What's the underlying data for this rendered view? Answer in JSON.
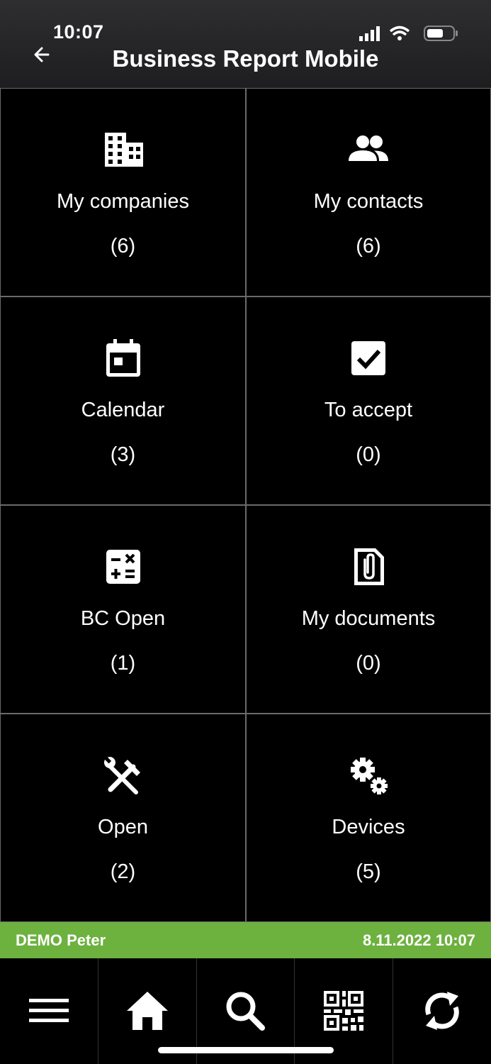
{
  "status_bar": {
    "time": "10:07"
  },
  "header": {
    "title": "Business Report Mobile",
    "back_icon": "arrow-left-icon"
  },
  "tiles": [
    {
      "icon": "building-icon",
      "label": "My companies",
      "count": "(6)"
    },
    {
      "icon": "people-icon",
      "label": "My contacts",
      "count": "(6)"
    },
    {
      "icon": "calendar-icon",
      "label": "Calendar",
      "count": "(3)"
    },
    {
      "icon": "checkbox-icon",
      "label": "To accept",
      "count": "(0)"
    },
    {
      "icon": "calculator-icon",
      "label": "BC Open",
      "count": "(1)"
    },
    {
      "icon": "paperclip-document-icon",
      "label": "My documents",
      "count": "(0)"
    },
    {
      "icon": "tools-icon",
      "label": "Open",
      "count": "(2)"
    },
    {
      "icon": "gears-icon",
      "label": "Devices",
      "count": "(5)"
    }
  ],
  "footer_status": {
    "user": "DEMO Peter",
    "timestamp": "8.11.2022 10:07",
    "color": "#6db13f"
  },
  "bottom_nav": [
    "menu-icon",
    "home-icon",
    "search-icon",
    "qr-code-icon",
    "sync-icon"
  ]
}
